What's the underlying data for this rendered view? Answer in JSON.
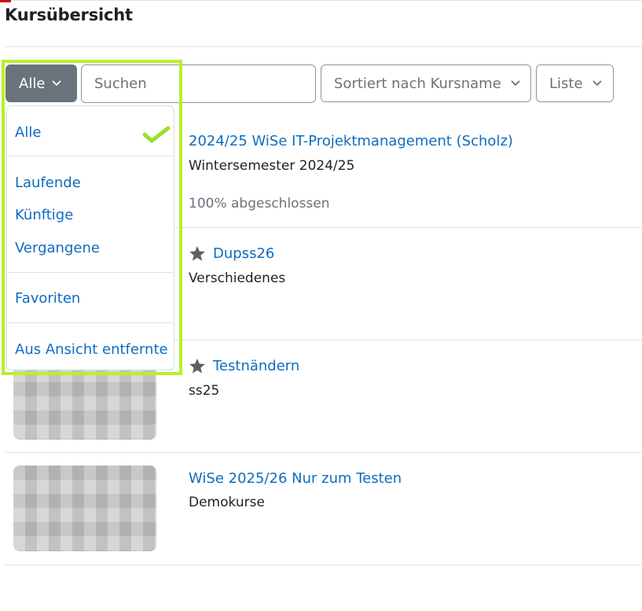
{
  "page": {
    "title": "Kursübersicht"
  },
  "toolbar": {
    "filter_label": "Alle",
    "search_placeholder": "Suchen",
    "sort_label": "Sortiert nach Kursname",
    "view_label": "Liste"
  },
  "filter_menu": {
    "items": [
      {
        "label": "Alle",
        "selected": true
      },
      {
        "label": "Laufende"
      },
      {
        "label": "Künftige"
      },
      {
        "label": "Vergangene"
      },
      {
        "label": "Favoriten"
      },
      {
        "label": "Aus Ansicht entfernte"
      }
    ]
  },
  "courses": [
    {
      "name": "2024/25 WiSe IT-Projektmanagement (Scholz)",
      "category": "Wintersemester 2024/25",
      "progress_text": "100% abgeschlossen",
      "progress": 100,
      "starred": false
    },
    {
      "name": "Dupss26",
      "category": "Verschiedenes",
      "starred": true
    },
    {
      "name": "Testnändern",
      "category": "ss25",
      "starred": true
    },
    {
      "name": "WiSe 2025/26 Nur zum Testen",
      "category": "Demokurse",
      "starred": false
    }
  ],
  "colors": {
    "link": "#0f6cbf",
    "filter_button_bg": "#6a737b",
    "highlight_border": "#b8f02a",
    "checkmark": "#9be02a"
  },
  "icons": {
    "chevron": "chevron-down-icon",
    "star": "star-icon",
    "check": "checkmark-icon"
  }
}
